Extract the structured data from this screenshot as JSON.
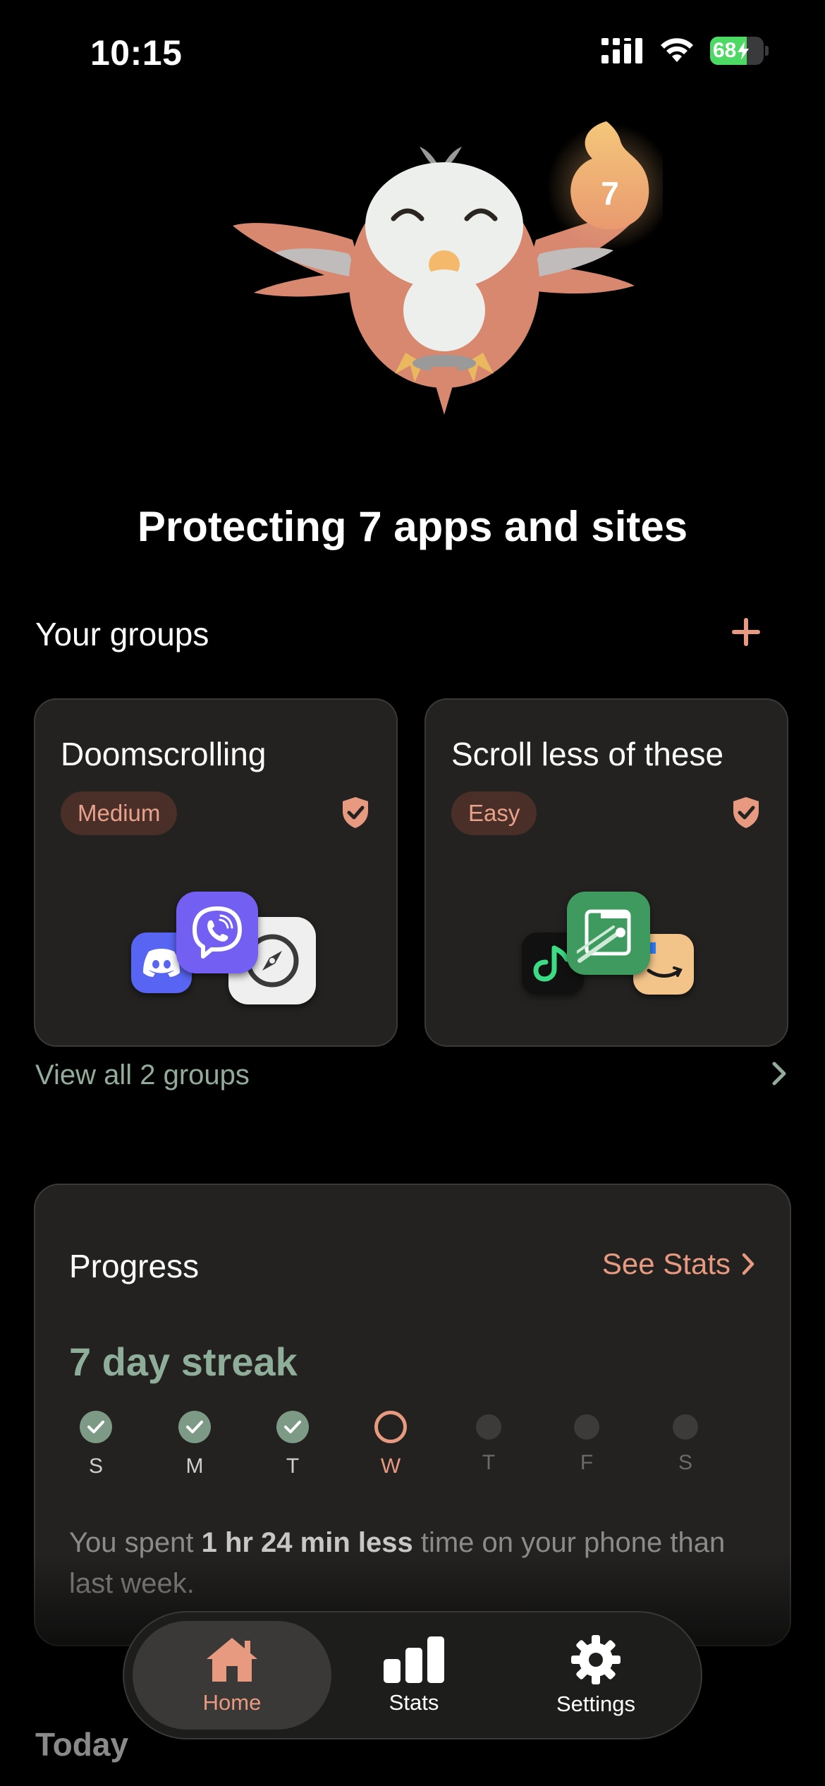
{
  "status_bar": {
    "time": "10:15",
    "battery": "68",
    "battery_level": 0.68
  },
  "mascot": {
    "streak_number": "7"
  },
  "headline": "Protecting 7 apps and sites",
  "groups": {
    "title": "Your groups",
    "add_icon": "plus-icon",
    "cards": [
      {
        "name": "Doomscrolling",
        "difficulty": "Medium",
        "apps": [
          "discord-icon",
          "viber-icon",
          "compass-icon"
        ]
      },
      {
        "name": "Scroll less of these",
        "difficulty": "Easy",
        "apps": [
          "green-app-icon",
          "feedly-icon",
          "amazon-icon"
        ]
      }
    ],
    "view_all": "View all 2 groups"
  },
  "progress": {
    "title": "Progress",
    "see_stats": "See Stats",
    "streak": "7 day streak",
    "days": [
      {
        "label": "S",
        "state": "done"
      },
      {
        "label": "M",
        "state": "done"
      },
      {
        "label": "T",
        "state": "done"
      },
      {
        "label": "W",
        "state": "current"
      },
      {
        "label": "T",
        "state": "future"
      },
      {
        "label": "F",
        "state": "future"
      },
      {
        "label": "S",
        "state": "future"
      }
    ],
    "summary_prefix": "You spent ",
    "summary_bold": "1 hr 24 min less",
    "summary_suffix": " time on your phone than last week."
  },
  "today_label": "Today",
  "tabs": [
    {
      "label": "Home",
      "icon": "home-icon",
      "active": true
    },
    {
      "label": "Stats",
      "icon": "bar-chart-icon",
      "active": false
    },
    {
      "label": "Settings",
      "icon": "gear-icon",
      "active": false
    }
  ],
  "colors": {
    "accent": "#e79a7f",
    "green": "#8fae99",
    "card": "#232221"
  }
}
